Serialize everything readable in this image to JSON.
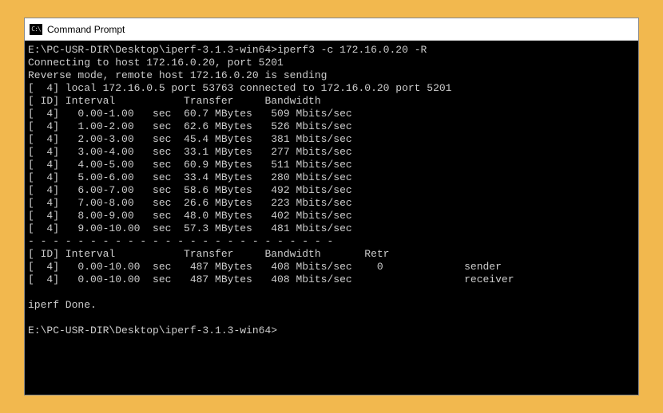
{
  "window": {
    "title": "Command Prompt",
    "icon_glyph": "C:\\"
  },
  "terminal": {
    "prompt1": "E:\\PC-USR-DIR\\Desktop\\iperf-3.1.3-win64>",
    "command": "iperf3 -c 172.16.0.20 -R",
    "connecting": "Connecting to host 172.16.0.20, port 5201",
    "reverse": "Reverse mode, remote host 172.16.0.20 is sending",
    "local": "[  4] local 172.16.0.5 port 53763 connected to 172.16.0.20 port 5201",
    "header1": "[ ID] Interval           Transfer     Bandwidth",
    "rows": [
      "[  4]   0.00-1.00   sec  60.7 MBytes   509 Mbits/sec",
      "[  4]   1.00-2.00   sec  62.6 MBytes   526 Mbits/sec",
      "[  4]   2.00-3.00   sec  45.4 MBytes   381 Mbits/sec",
      "[  4]   3.00-4.00   sec  33.1 MBytes   277 Mbits/sec",
      "[  4]   4.00-5.00   sec  60.9 MBytes   511 Mbits/sec",
      "[  4]   5.00-6.00   sec  33.4 MBytes   280 Mbits/sec",
      "[  4]   6.00-7.00   sec  58.6 MBytes   492 Mbits/sec",
      "[  4]   7.00-8.00   sec  26.6 MBytes   223 Mbits/sec",
      "[  4]   8.00-9.00   sec  48.0 MBytes   402 Mbits/sec",
      "[  4]   9.00-10.00  sec  57.3 MBytes   481 Mbits/sec"
    ],
    "divider": "- - - - - - - - - - - - - - - - - - - - - - - - -",
    "header2": "[ ID] Interval           Transfer     Bandwidth       Retr",
    "summary": [
      "[  4]   0.00-10.00  sec   487 MBytes   408 Mbits/sec    0             sender",
      "[  4]   0.00-10.00  sec   487 MBytes   408 Mbits/sec                  receiver"
    ],
    "done": "iperf Done.",
    "prompt2": "E:\\PC-USR-DIR\\Desktop\\iperf-3.1.3-win64>"
  }
}
